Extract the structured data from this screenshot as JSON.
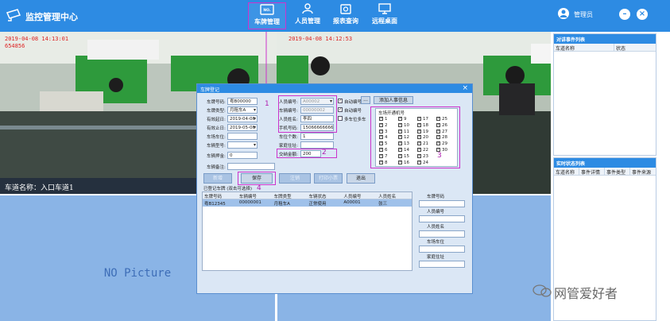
{
  "app": {
    "title": "监控管理中心"
  },
  "nav": [
    {
      "label": "车牌管理",
      "icon": "license-plate-icon"
    },
    {
      "label": "人员管理",
      "icon": "person-icon"
    },
    {
      "label": "报表查询",
      "icon": "report-icon"
    },
    {
      "label": "远程桌面",
      "icon": "monitor-icon"
    }
  ],
  "nav_plate_badge": "NO.",
  "user": {
    "label": "管理员"
  },
  "window_buttons": {
    "minimize": "–",
    "close": "×"
  },
  "cameras": {
    "left": {
      "timestamp": "2019-04-08 14:13:01",
      "id": "654856",
      "lane_name": "车道名称：入口车道1"
    },
    "right": {
      "timestamp": "2019-04-08 14:12:53"
    },
    "empty_left": "NO Picture",
    "empty_right": "NO Picture"
  },
  "panels": {
    "events": {
      "title": "对讲事件列表",
      "columns": [
        "车道名称",
        "状态"
      ]
    },
    "status": {
      "title": "实时状态列表",
      "columns": [
        "车道名称",
        "事件详情",
        "事件类型",
        "事件来源"
      ]
    }
  },
  "watermark": "网管爱好者",
  "dialog": {
    "title": "车牌登记",
    "close": "×",
    "fields": {
      "plate_no": {
        "label": "车牌号码:",
        "value": "粤B00000"
      },
      "plate_type": {
        "label": "车牌类型:",
        "value": "月租车A"
      },
      "valid_from": {
        "label": "有效起日:",
        "value": "2019-04-06"
      },
      "valid_to": {
        "label": "有效止日:",
        "value": "2019-05-06"
      },
      "parking_spot": {
        "label": "车场车位:",
        "value": ""
      },
      "car_model": {
        "label": "车辆型号:",
        "value": ""
      },
      "deposit": {
        "label": "车辆押金:",
        "value": "0"
      },
      "remark": {
        "label": "车辆备注:",
        "value": ""
      },
      "person_no": {
        "label": "人员编号:",
        "value": "A00002"
      },
      "vehicle_no": {
        "label": "车辆编号:",
        "value": "00000002"
      },
      "person_name": {
        "label": "人员姓名:",
        "value": "李四"
      },
      "phone": {
        "label": "手机号码:",
        "value": "15066666666"
      },
      "spot_count": {
        "label": "车位个数:",
        "value": "1"
      },
      "home_address": {
        "label": "家庭住址:",
        "value": ""
      },
      "payment": {
        "label": "交纳金额:",
        "value": "200"
      }
    },
    "auto_no_1": "自动编号",
    "auto_no_2": "自动编号",
    "multi_spot": "多车位多车",
    "add_person_button": "添加人事信息",
    "more_button": "...",
    "gates": {
      "title": "车场开通机号",
      "items": [
        "1",
        "2",
        "3",
        "4",
        "5",
        "6",
        "7",
        "8",
        "9",
        "10",
        "11",
        "12",
        "13",
        "14",
        "15",
        "16",
        "17",
        "18",
        "19",
        "20",
        "21",
        "22",
        "23",
        "24",
        "25",
        "26",
        "27",
        "28",
        "29",
        "30"
      ]
    },
    "buttons": {
      "new": "新增",
      "save": "保存",
      "cancel": "注销",
      "print": "打印小票",
      "exit": "退出"
    },
    "registered_title": "已登记车牌 (双击可选择)",
    "table": {
      "columns": [
        "车牌号码",
        "车辆编号",
        "车牌类型",
        "车辆状态",
        "人员编号",
        "人员姓名"
      ],
      "rows": [
        [
          "粤B12345",
          "00000001",
          "月租车A",
          "正常使用",
          "A00001",
          "张三"
        ]
      ]
    },
    "side_form": {
      "plate_no": "车牌号码",
      "person_no": "人员编号",
      "person_name": "人员姓名",
      "parking_spot": "车场车位",
      "home_address": "家庭住址"
    },
    "annotations": [
      "1",
      "2",
      "3",
      "4"
    ]
  }
}
